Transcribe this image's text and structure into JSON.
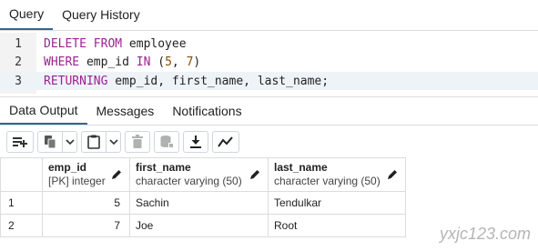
{
  "editor_tabs": [
    {
      "label": "Query",
      "active": true
    },
    {
      "label": "Query History",
      "active": false
    }
  ],
  "code": {
    "lines": [
      {
        "number": "1",
        "tokens": [
          [
            "kw",
            "DELETE FROM"
          ],
          [
            "txt",
            " employee"
          ]
        ]
      },
      {
        "number": "2",
        "tokens": [
          [
            "kw",
            "WHERE"
          ],
          [
            "txt",
            " emp_id "
          ],
          [
            "kw",
            "IN"
          ],
          [
            "txt",
            " ("
          ],
          [
            "num",
            "5"
          ],
          [
            "txt",
            ", "
          ],
          [
            "num",
            "7"
          ],
          [
            "txt",
            ")"
          ]
        ]
      },
      {
        "number": "3",
        "tokens": [
          [
            "kw",
            "RETURNING"
          ],
          [
            "txt",
            " emp_id, first_name, last_name;"
          ]
        ]
      }
    ]
  },
  "output_tabs": [
    {
      "label": "Data Output",
      "active": true
    },
    {
      "label": "Messages",
      "active": false
    },
    {
      "label": "Notifications",
      "active": false
    }
  ],
  "toolbar": {
    "buttons": [
      {
        "name": "add-row-icon"
      },
      {
        "name": "copy-icon"
      },
      {
        "name": "paste-icon"
      },
      {
        "name": "delete-icon"
      },
      {
        "name": "save-data-icon"
      },
      {
        "name": "download-icon"
      },
      {
        "name": "graph-visualiser-icon"
      }
    ]
  },
  "grid": {
    "columns": [
      {
        "name": "emp_id",
        "type": "[PK] integer"
      },
      {
        "name": "first_name",
        "type": "character varying (50)"
      },
      {
        "name": "last_name",
        "type": "character varying (50)"
      }
    ],
    "rows": [
      {
        "row_number": "1",
        "emp_id": "5",
        "first_name": "Sachin",
        "last_name": "Tendulkar"
      },
      {
        "row_number": "2",
        "emp_id": "7",
        "first_name": "Joe",
        "last_name": "Root"
      }
    ]
  },
  "watermark": "yxjc123.com",
  "colors": {
    "keyword": "#9b2393",
    "number": "#8a4d00",
    "active_tab_underline": "#326690"
  }
}
